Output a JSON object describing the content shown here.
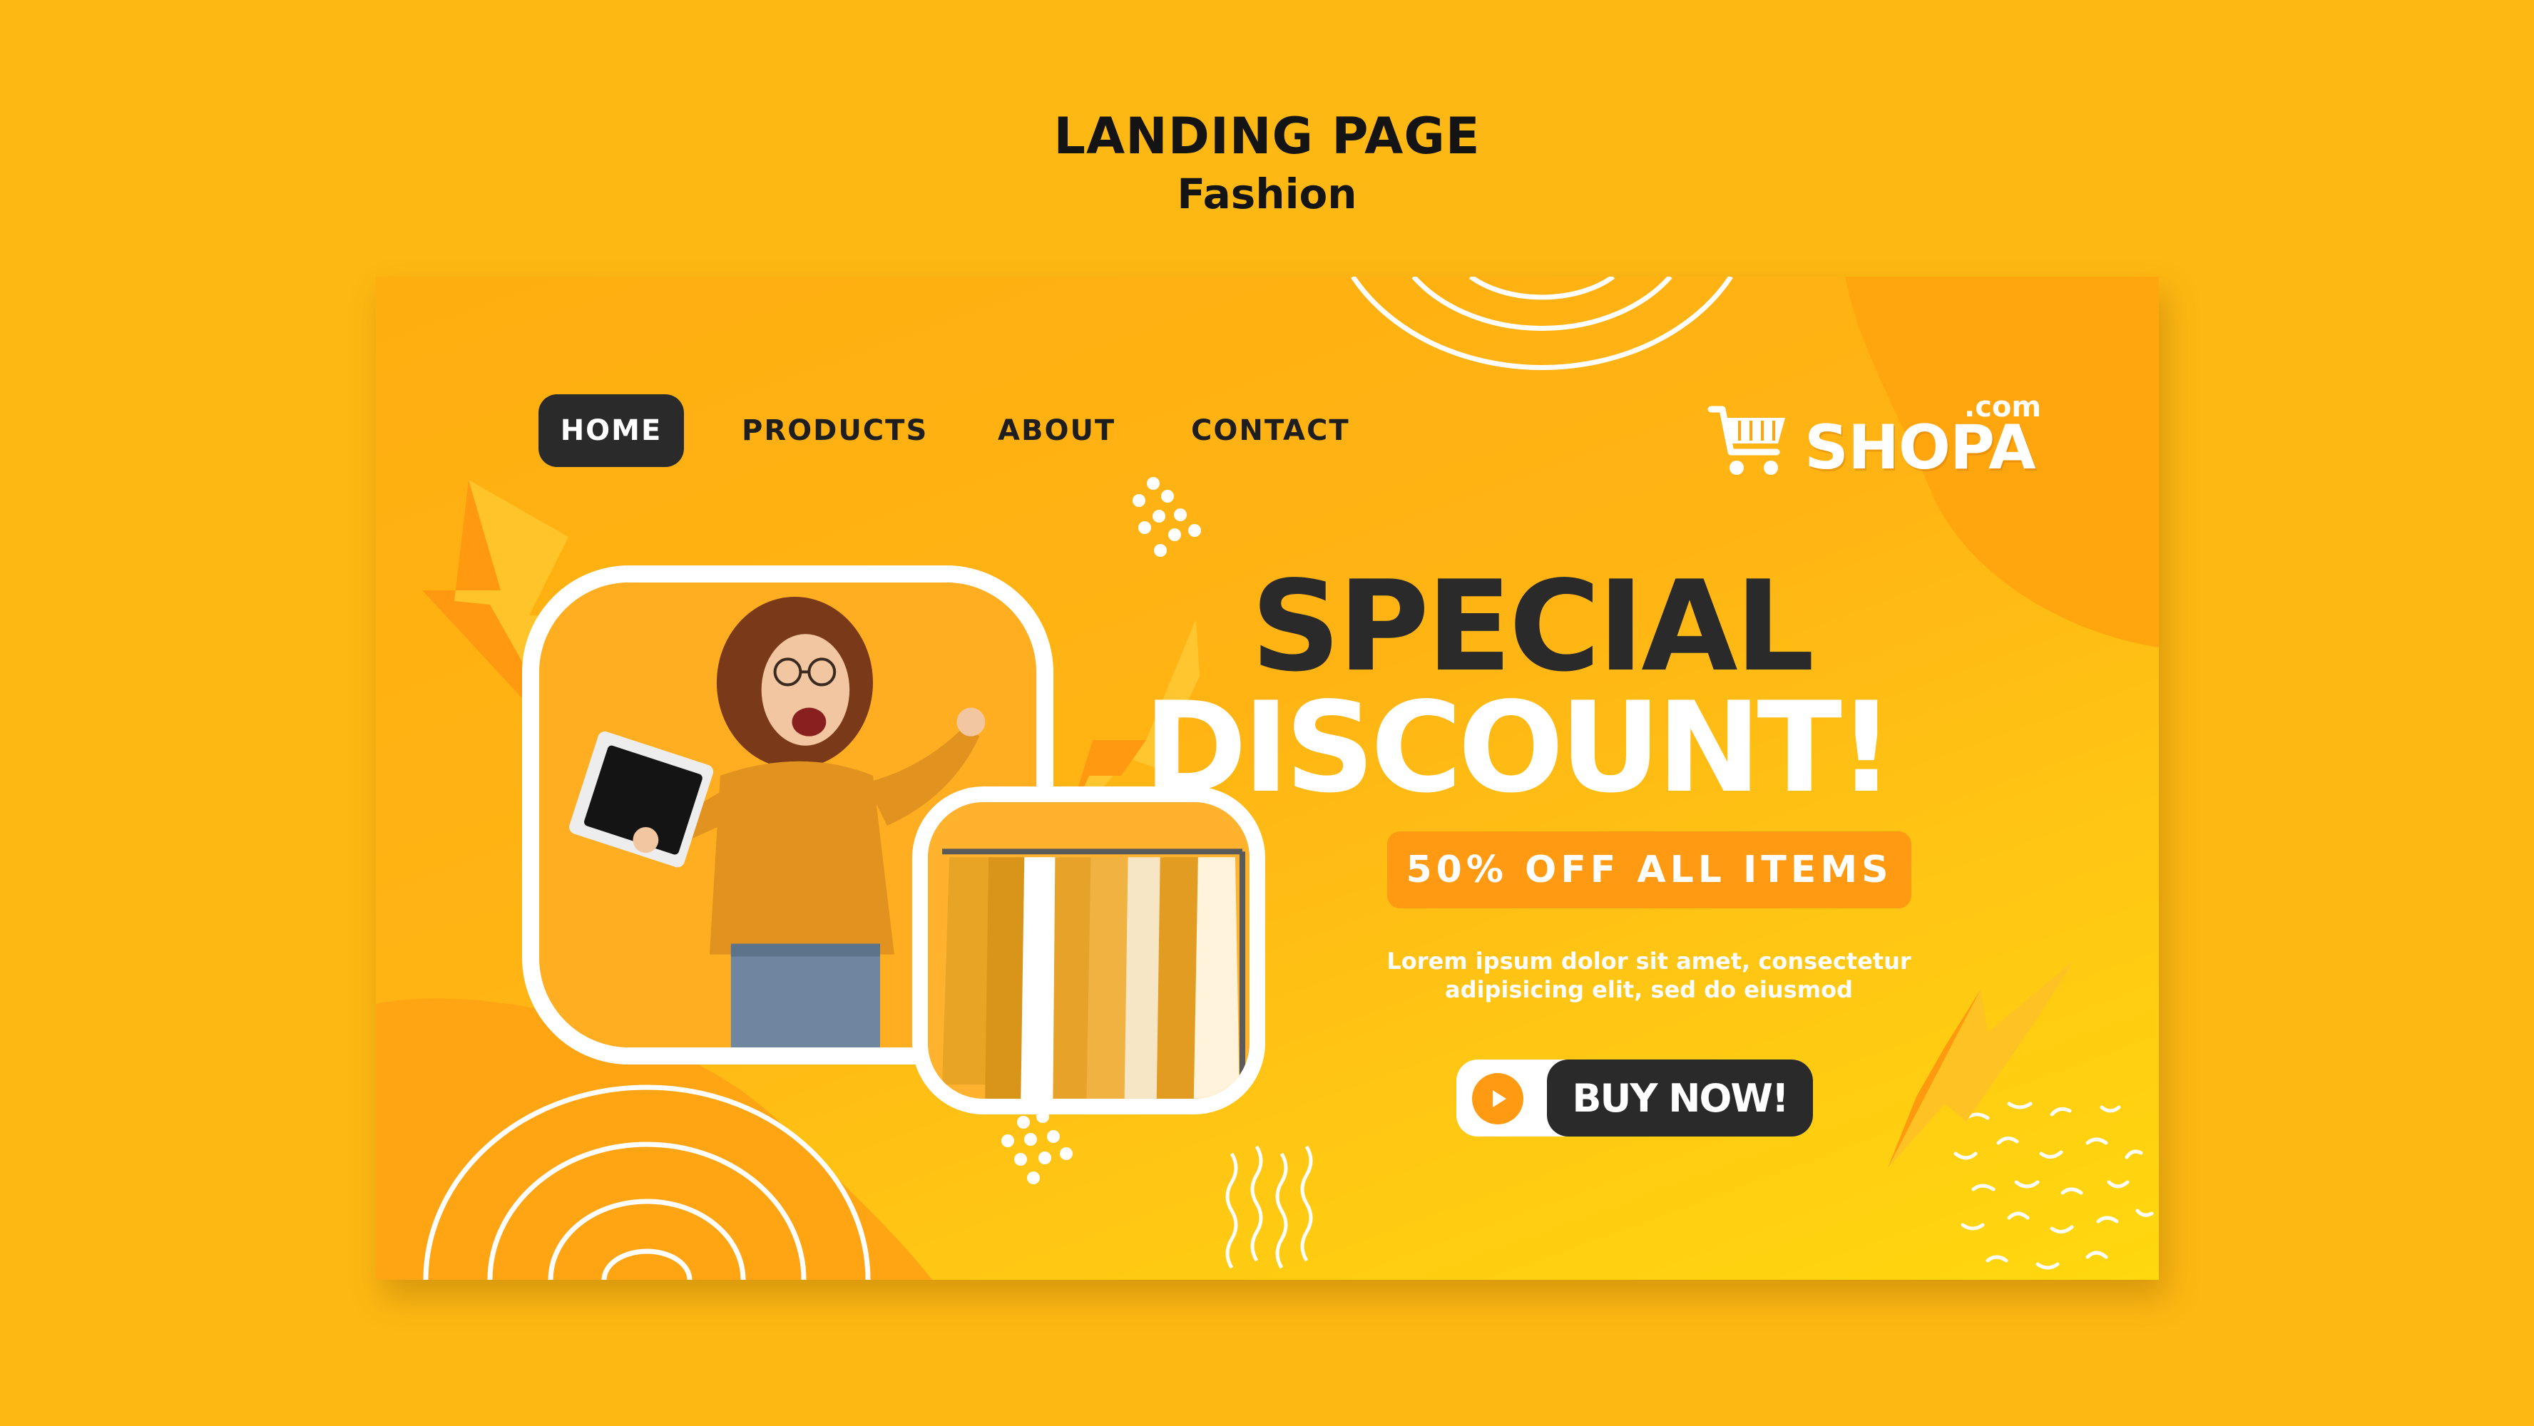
{
  "header": {
    "title": "LANDING PAGE",
    "subtitle": "Fashion"
  },
  "nav": {
    "items": [
      {
        "label": "HOME",
        "active": true
      },
      {
        "label": "PRODUCTS"
      },
      {
        "label": "ABOUT"
      },
      {
        "label": "CONTACT"
      }
    ]
  },
  "logo": {
    "icon": "shopping-cart-icon",
    "text": "SHOPA",
    "suffix": ".com"
  },
  "hero": {
    "headline_1": "SPECIAL",
    "headline_2": "DISCOUNT!",
    "offer": "50% OFF ALL ITEMS",
    "description_line_1": "Lorem ipsum dolor sit amet, consectetur",
    "description_line_2": "adipisicing elit, sed do eiusmod",
    "cta_label": "BUY NOW!",
    "cta_icon": "play-icon"
  },
  "colors": {
    "page_background": "#FDB813",
    "accent_orange": "#FF9A12",
    "dark": "#2A2A2A",
    "white": "#FFFFFF",
    "gradient_bottom": "#FFD80E"
  }
}
